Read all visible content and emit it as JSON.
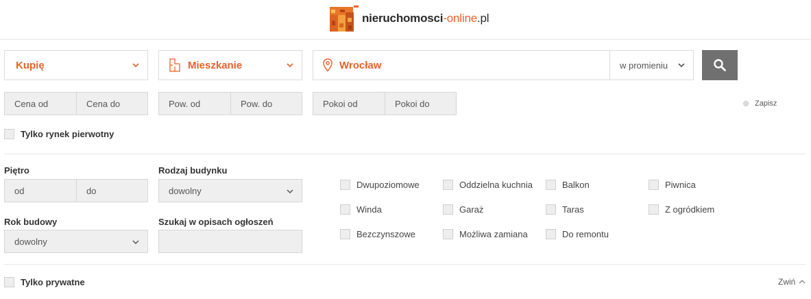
{
  "logo": {
    "name_main": "nieruchomosci",
    "name_accent": "-online",
    "name_tld": ".pl"
  },
  "search": {
    "transaction": "Kupię",
    "property_type": "Mieszkanie",
    "location": "Wrocław",
    "radius": "w promieniu"
  },
  "price": {
    "from": "Cena od",
    "to": "Cena do"
  },
  "area": {
    "from": "Pow. od",
    "to": "Pow. do"
  },
  "rooms": {
    "from": "Pokoi od",
    "to": "Pokoi do"
  },
  "save_label": "Zapisz",
  "primary_market_label": "Tylko rynek pierwotny",
  "floor": {
    "label": "Piętro",
    "from": "od",
    "to": "do"
  },
  "building_type": {
    "label": "Rodzaj budynku",
    "value": "dowolny"
  },
  "build_year": {
    "label": "Rok budowy",
    "value": "dowolny"
  },
  "description_search": {
    "label": "Szukaj w opisach ogłoszeń",
    "value": ""
  },
  "features": {
    "col1": [
      "Dwupoziomowe",
      "Winda",
      "Bezczynszowe"
    ],
    "col2": [
      "Oddzielna kuchnia",
      "Garaż",
      "Możliwa zamiana"
    ],
    "col3": [
      "Balkon",
      "Taras",
      "Do remontu"
    ],
    "col4": [
      "Piwnica",
      "Z ogródkiem"
    ]
  },
  "private_only_label": "Tylko prywatne",
  "collapse_label": "Zwiń",
  "colors": {
    "accent": "#e8622a",
    "search_button": "#707070"
  }
}
